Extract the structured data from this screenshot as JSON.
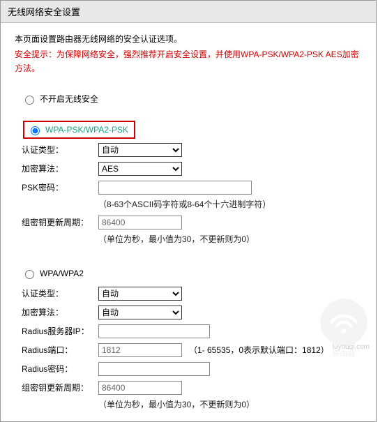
{
  "title": "无线网络安全设置",
  "intro": "本页面设置路由器无线网络的安全认证选项。",
  "warning": "安全提示：为保障网络安全，强烈推荐开启安全设置，并使用WPA-PSK/WPA2-PSK AES加密方法。",
  "radios": {
    "disable": "不开启无线安全",
    "wpa_psk": "WPA-PSK/WPA2-PSK",
    "wpa": "WPA/WPA2"
  },
  "labels": {
    "auth_type": "认证类型：",
    "cipher": "加密算法：",
    "psk": "PSK密码：",
    "group_rekey": "组密钥更新周期：",
    "radius_ip": "Radius服务器IP：",
    "radius_port": "Radius端口：",
    "radius_pw": "Radius密码："
  },
  "wpa_psk": {
    "auth_type": "自动",
    "cipher": "AES",
    "psk_value": "",
    "psk_hint": "（8-63个ASCII码字符或8-64个十六进制字符）",
    "rekey_value": "86400",
    "rekey_hint": "（单位为秒，最小值为30，不更新则为0）"
  },
  "wpa": {
    "auth_type": "自动",
    "cipher": "自动",
    "radius_ip": "",
    "radius_port": "1812",
    "radius_port_hint": "（1- 65535，0表示默认端口：1812）",
    "radius_pw": "",
    "rekey_value": "86400",
    "rekey_hint": "（单位为秒，最小值为30，不更新则为0）"
  },
  "watermark_text": "路由器",
  "watermark_url": "luyouqi.com"
}
